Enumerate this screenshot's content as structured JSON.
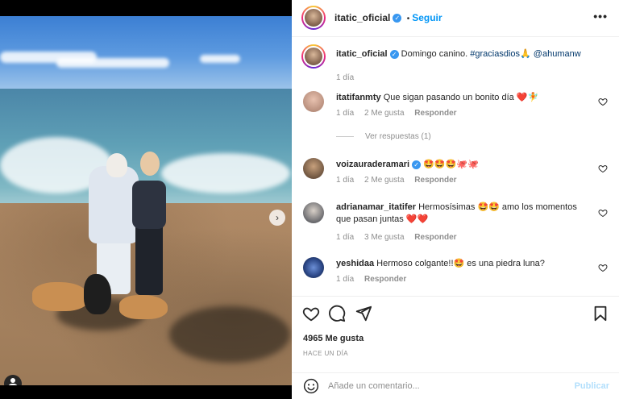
{
  "post": {
    "author": "itatic_oficial",
    "follow_label": "Seguir",
    "dot_separator": "•",
    "more_label": "•••",
    "caption_text": "Domingo canino.",
    "caption_hashtag": "#graciasdios",
    "caption_emoji": "🙏",
    "caption_mention": "@ahumanw",
    "caption_age": "1 día"
  },
  "comments": [
    {
      "username": "itatifanmty",
      "text": "Que sigan pasando un bonito día ❤️🧚",
      "age": "1 día",
      "likes": "2 Me gusta",
      "reply": "Responder",
      "view_replies": "Ver respuestas (1)"
    },
    {
      "username": "voizauraderamari",
      "verified": true,
      "text": "🤩🤩🤩🐙🐙",
      "age": "1 día",
      "likes": "2 Me gusta",
      "reply": "Responder"
    },
    {
      "username": "adrianamar_itatifer",
      "text": "Hermosísimas 🤩🤩 amo los momentos que pasan juntas ❤️❤️",
      "age": "1 día",
      "likes": "3 Me gusta",
      "reply": "Responder"
    },
    {
      "username": "yeshidaa",
      "text": "Hermoso colgante!!🤩 es una piedra luna?",
      "age": "1 día",
      "reply": "Responder"
    }
  ],
  "footer": {
    "likes_count": "4965 Me gusta",
    "time_ago": "HACE UN DÍA",
    "comment_placeholder": "Añade un comentario...",
    "publish_label": "Publicar"
  },
  "icons": {
    "like": "heart-icon",
    "comment": "comment-icon",
    "share": "share-icon",
    "save": "bookmark-icon",
    "emoji": "smiley-icon",
    "next": "chevron-right-icon",
    "tags": "user-tag-icon"
  },
  "colors": {
    "accent": "#0095f6",
    "verified": "#3897f0",
    "muted": "#8e8e8e",
    "publish_disabled": "#b2dffc"
  }
}
